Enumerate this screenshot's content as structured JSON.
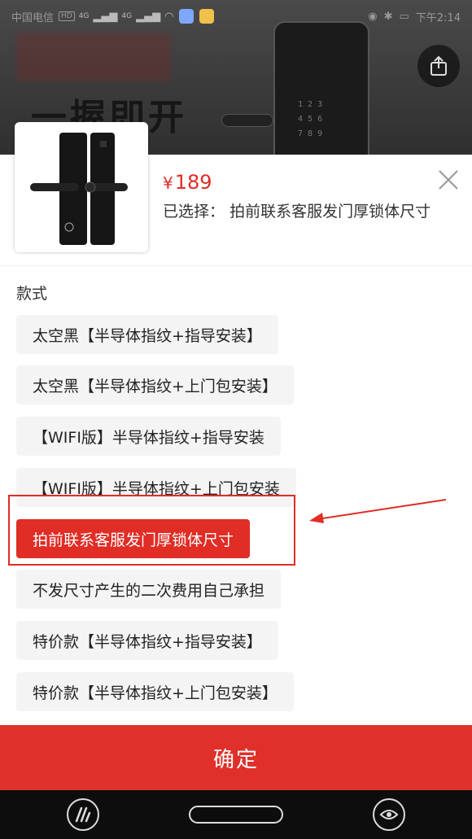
{
  "status_bar": {
    "carrier": "中国电信",
    "hd_badge": "HD",
    "network_1": "4G",
    "network_2": "4G",
    "time": "下午2:14"
  },
  "background": {
    "headline": "一握即开"
  },
  "sheet": {
    "price_symbol": "¥",
    "price_value": "189",
    "selected_prefix": "已选择：",
    "selected_value": "拍前联系客服发门厚锁体尺寸",
    "section_title": "款式",
    "options": [
      {
        "label": "太空黑【半导体指纹+指导安装】",
        "selected": false
      },
      {
        "label": "太空黑【半导体指纹+上门包安装】",
        "selected": false
      },
      {
        "label": "【WIFI版】半导体指纹+指导安装",
        "selected": false
      },
      {
        "label": "【WIFI版】半导体指纹+上门包安装",
        "selected": false
      },
      {
        "label": "拍前联系客服发门厚锁体尺寸",
        "selected": true
      },
      {
        "label": "不发尺寸产生的二次费用自己承担",
        "selected": false
      },
      {
        "label": "特价款【半导体指纹+指导安装】",
        "selected": false
      },
      {
        "label": "特价款【半导体指纹+上门包安装】",
        "selected": false
      }
    ],
    "confirm_label": "确定"
  },
  "colors": {
    "accent": "#e02d25",
    "option_bg": "#f4f4f4",
    "nav_bg": "#0d0d0d"
  },
  "icons": [
    "share-icon",
    "close-icon",
    "nav-app-icon",
    "nav-home-pill",
    "nav-eye-icon"
  ]
}
